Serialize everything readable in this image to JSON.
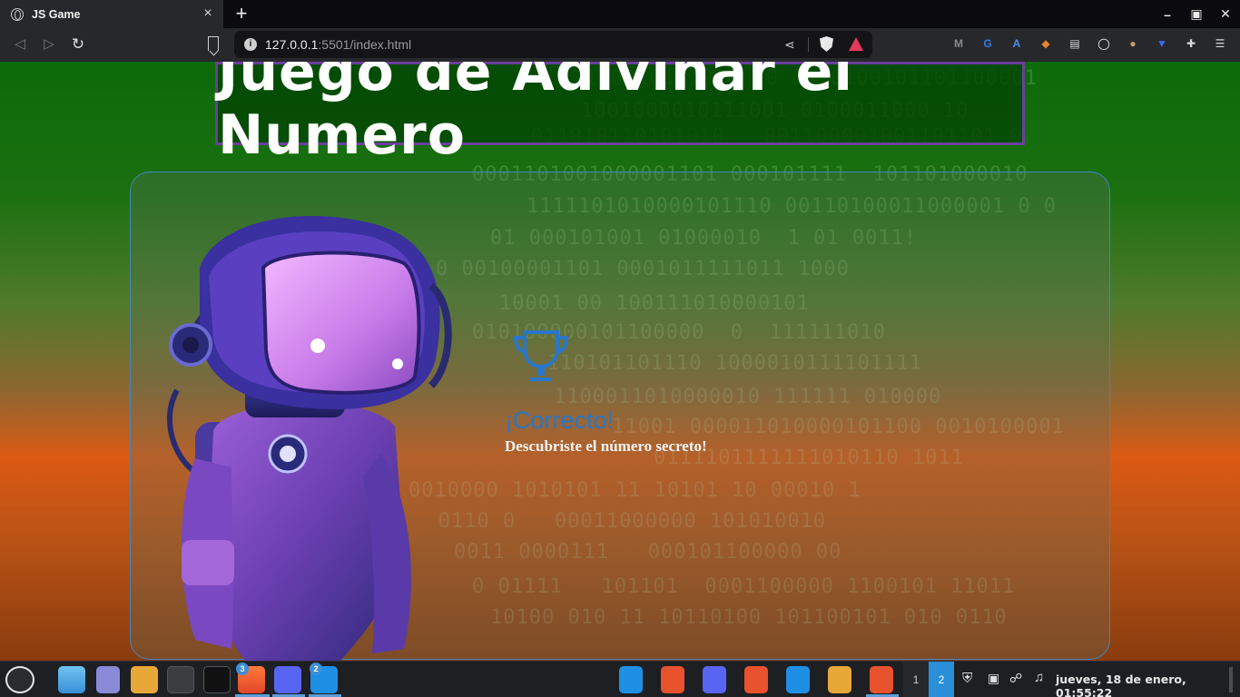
{
  "browser": {
    "tab_title": "JS Game",
    "tab_close": "×",
    "new_tab": "+",
    "window_controls": {
      "minimize": "–",
      "maximize": "▣",
      "close": "✕"
    },
    "url_host": "127.0.0.1",
    "url_rest": ":5501/index.html",
    "extensions": [
      {
        "name": "metamask-m-icon",
        "glyph": "M",
        "color": "#8a8a8a"
      },
      {
        "name": "translate-icon",
        "glyph": "G",
        "color": "#3b7be0"
      },
      {
        "name": "translate-alt-icon",
        "glyph": "A",
        "color": "#4a8fe8"
      },
      {
        "name": "fox-icon",
        "glyph": "◆",
        "color": "#e8822b"
      },
      {
        "name": "reader-icon",
        "glyph": "▤",
        "color": "#d8d8d8"
      },
      {
        "name": "profile-icon",
        "glyph": "◯",
        "color": "#ffffff"
      },
      {
        "name": "owl-icon",
        "glyph": "●",
        "color": "#c79a6a"
      },
      {
        "name": "bitwarden-icon",
        "glyph": "▼",
        "color": "#3a6ee8"
      },
      {
        "name": "puzzle-icon",
        "glyph": "✚",
        "color": "#d8d8d8"
      },
      {
        "name": "menu-icon",
        "glyph": "☰",
        "color": "#d8d8d8"
      }
    ]
  },
  "page": {
    "title": "Juego de Adivinar el Numero",
    "result_title": "¡Correcto!",
    "result_subtitle": "Descubriste el número secreto!",
    "binary_rows": [
      "11 0010111010 10 0110100101101100001",
      "1001000010111001 0100011000 10",
      "011010110101010   001100001001101101 0",
      "0001101001000001101 000101111  101101000010",
      "1111101010000101110 00110100011000001 0 0",
      "01 000101001 01000010  1 01 0011!",
      "0 00100001101 0001011111011 1000",
      "10001 00 100111010000101  ",
      "010100000101100000  0  111111010",
      "   110101101110 1000010111101111",
      "1100011010000010 111111 010000",
      " 11001 000011010000101100 0010100001",
      "0111101111111010110 1011",
      "0010000 1010101 11 10101 10 00010 1",
      "   0110 0   00011000000 101010010",
      "0011 0000111   000101100000 00",
      "0 01111   101101  0001100000 1100101 11011",
      "10100 010 11 10110100 101100101 010 0110"
    ]
  },
  "taskbar": {
    "workspaces": [
      "1",
      "2"
    ],
    "clock": "jueves, 18 de enero, 01:55:22",
    "badges": {
      "brave": "3",
      "vscode": "2"
    }
  }
}
